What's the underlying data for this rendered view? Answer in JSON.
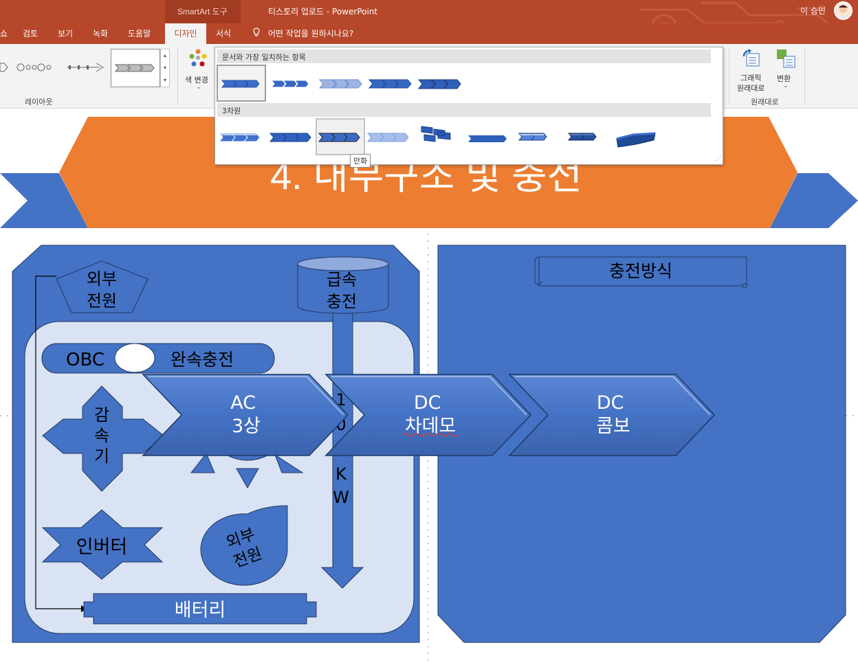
{
  "titlebar": {
    "context_label": "SmartArt 도구",
    "document_title": "티스토리 업로드  -  PowerPoint",
    "user_name": "이 승민"
  },
  "tabs": {
    "partial": "쇼",
    "items": [
      "검토",
      "보기",
      "녹화",
      "도움말"
    ],
    "active": "디자인",
    "format": "서식",
    "tell_me": "어떤 작업을 원하시나요?"
  },
  "ribbon": {
    "layout_group_label": "레이아웃",
    "change_colors_label": "색 변경",
    "convert_to_graphic_label": "그래픽\n원래대로",
    "convert_label": "변환",
    "reset_group_label": "원래대로"
  },
  "gallery": {
    "section_best_match": "문서와 가장 일치하는 항목",
    "section_3d": "3차원",
    "tooltip": "만화",
    "best_match_count": 5,
    "three_d_count": 9
  },
  "slide": {
    "title": "4. 내부구조 및 충전",
    "left_panel": {
      "external_power_1": "외부\n전원",
      "fast_charge": "급속\n충전",
      "obc": "OBC",
      "slow_charge": "완속충전",
      "reducer": "감\n속\n기",
      "inverter": "인버터",
      "external_power_2": "외부\n전원",
      "battery": "배터리",
      "vertical_label": "100KW"
    },
    "chevrons": [
      {
        "line1": "AC",
        "line2": "3상"
      },
      {
        "line1": "DC",
        "line2": "차데모"
      },
      {
        "line1": "DC",
        "line2": "콤보"
      }
    ],
    "right_panel": {
      "scroll_label": "충전방식"
    }
  },
  "colors": {
    "titlebar": "#b7472a",
    "ribbon": "#f3f3f3",
    "accent_blue": "#4472c4",
    "orange": "#ed7d31",
    "light_panel": "#dae3f3"
  }
}
